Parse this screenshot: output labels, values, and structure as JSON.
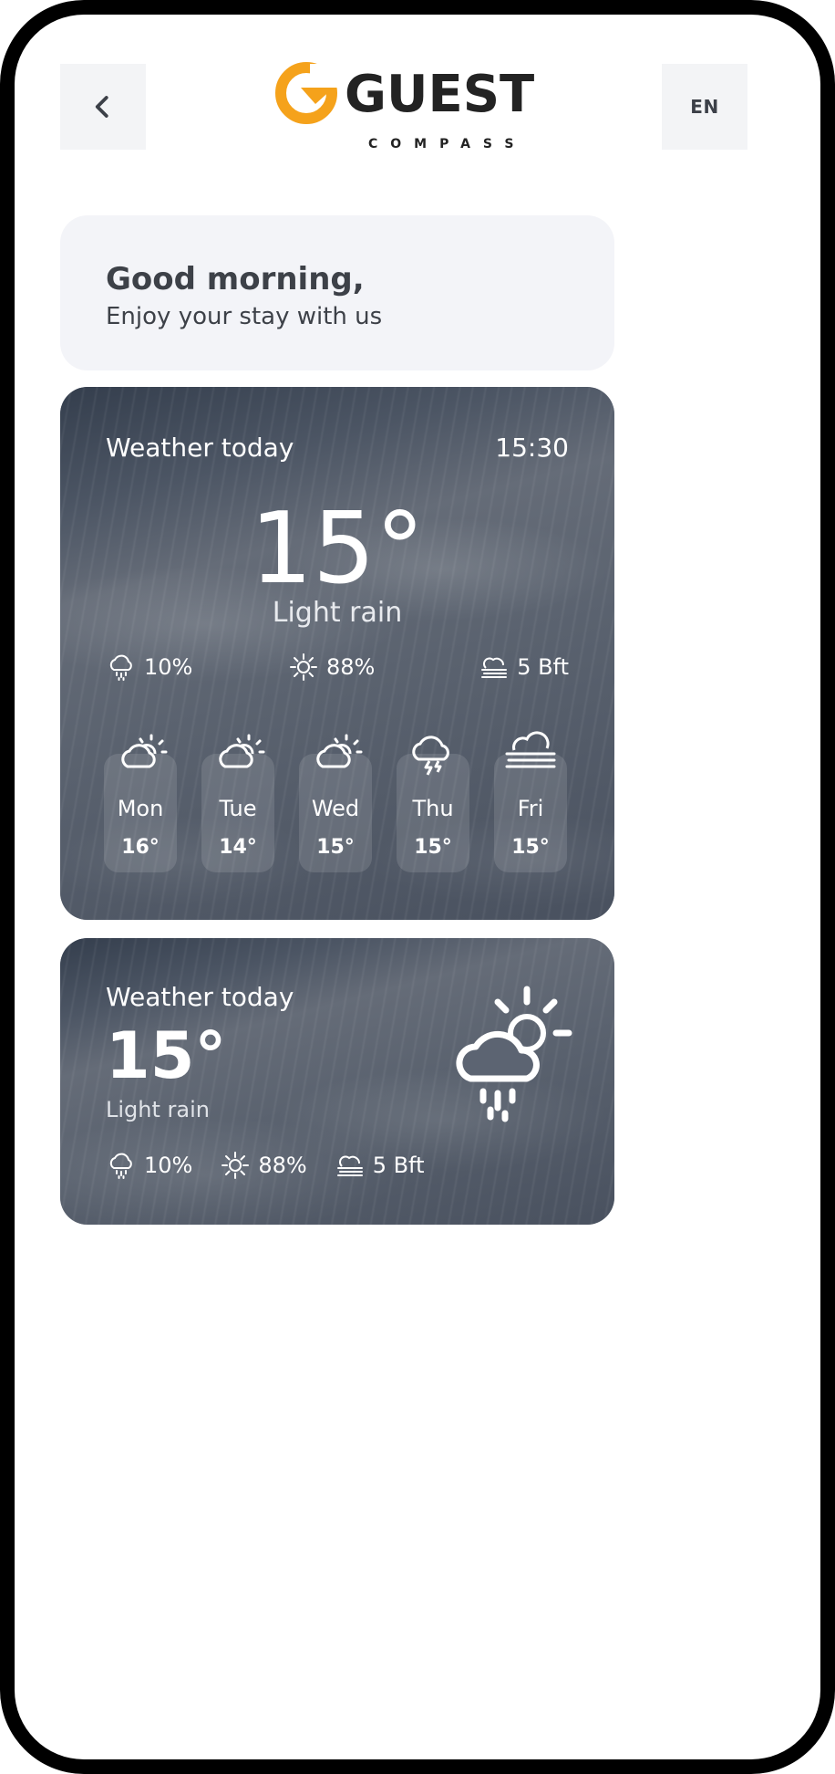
{
  "header": {
    "back_icon": "chevron-left-icon",
    "logo_word": "GUEST",
    "logo_sub": "COMPASS",
    "language": "EN",
    "colors": {
      "logo_accent": "#f5a21b",
      "logo_text": "#232323"
    }
  },
  "greeting": {
    "title": "Good morning,",
    "subtitle": "Enjoy your stay with us"
  },
  "weather_card": {
    "label": "Weather today",
    "time": "15:30",
    "temperature": "15°",
    "condition": "Light rain",
    "stats": {
      "precipitation": {
        "icon": "rain-cloud-icon",
        "value": "10%"
      },
      "sun": {
        "icon": "sun-icon",
        "value": "88%"
      },
      "wind": {
        "icon": "fog-wind-icon",
        "value": "5 Bft"
      }
    },
    "forecast": [
      {
        "day": "Mon",
        "temp": "16°",
        "icon": "partly-cloudy-icon"
      },
      {
        "day": "Tue",
        "temp": "14°",
        "icon": "partly-cloudy-icon"
      },
      {
        "day": "Wed",
        "temp": "15°",
        "icon": "partly-cloudy-icon"
      },
      {
        "day": "Thu",
        "temp": "15°",
        "icon": "thunderstorm-icon"
      },
      {
        "day": "Fri",
        "temp": "15°",
        "icon": "fog-icon"
      }
    ]
  },
  "weather_compact": {
    "label": "Weather today",
    "temperature": "15°",
    "condition": "Light rain",
    "icon": "sun-cloud-rain-icon",
    "stats": {
      "precipitation": "10%",
      "sun": "88%",
      "wind": "5 Bft"
    }
  }
}
